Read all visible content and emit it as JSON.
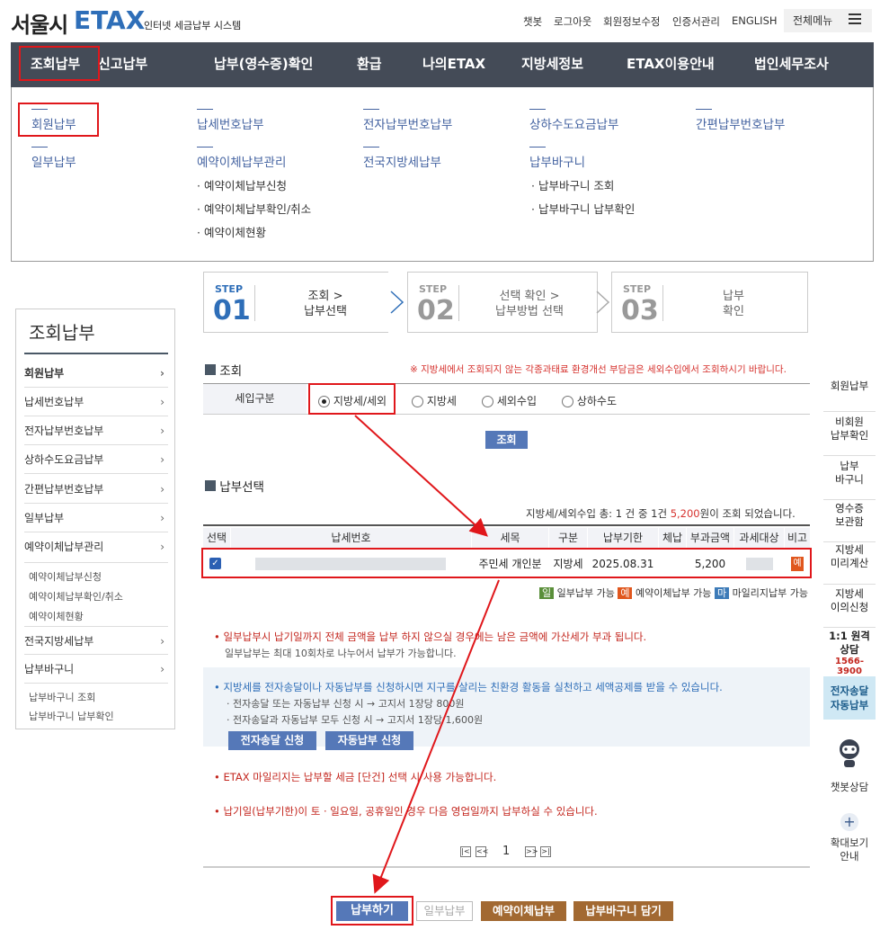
{
  "header": {
    "logo_main": "서울시",
    "logo_etax": "ETAX",
    "logo_sub": "인터넷 세금납부 시스템",
    "util": [
      "챗봇",
      "로그아웃",
      "회원정보수정",
      "인증서관리",
      "ENGLISH"
    ],
    "all_menu": "전체메뉴"
  },
  "gnb": [
    "조회납부",
    "신고납부",
    "납부(영수증)확인",
    "환급",
    "나의ETAX",
    "지방세정보",
    "ETAX이용안내",
    "법인세무조사"
  ],
  "mega": {
    "col1": [
      "회원납부",
      "일부납부"
    ],
    "col2": [
      "납세번호납부",
      "예약이체납부관리"
    ],
    "col2_sub": [
      "· 예약이체납부신청",
      "· 예약이체납부확인/취소",
      "· 예약이체현황"
    ],
    "col3": [
      "전자납부번호납부",
      "전국지방세납부"
    ],
    "col4": [
      "상하수도요금납부",
      "납부바구니"
    ],
    "col4_sub": [
      "· 납부바구니 조회",
      "· 납부바구니 납부확인"
    ],
    "col5": [
      "간편납부번호납부"
    ]
  },
  "steps": [
    {
      "label": "STEP",
      "num": "01",
      "text1": "조회 >",
      "text2": "납부선택"
    },
    {
      "label": "STEP",
      "num": "02",
      "text1": "선택 확인 >",
      "text2": "납부방법 선택"
    },
    {
      "label": "STEP",
      "num": "03",
      "text1": "납부",
      "text2": "확인"
    }
  ],
  "lnb": {
    "title": "조회납부",
    "items": [
      "회원납부",
      "납세번호납부",
      "전자납부번호납부",
      "상하수도요금납부",
      "간편납부번호납부",
      "일부납부",
      "예약이체납부관리"
    ],
    "sub1": [
      "예약이체납부신청",
      "예약이체납부확인/취소",
      "예약이체현황"
    ],
    "items2": [
      "전국지방세납부",
      "납부바구니"
    ],
    "sub2": [
      "납부바구니 조회",
      "납부바구니 납부확인"
    ]
  },
  "search": {
    "title": "조회",
    "notice": "※ 지방세에서 조회되지 않는 각종과태료 환경개선 부담금은 세외수입에서 조회하시기 바랍니다.",
    "row_label": "세입구분",
    "options": [
      "지방세/세외",
      "지방세",
      "세외수입",
      "상하수도"
    ],
    "button": "조회"
  },
  "select": {
    "title": "납부선택",
    "summary_pre": "지방세/세외수입 총: 1 건 중 1건",
    "summary_amt": "5,200",
    "summary_post": "원이 조회 되었습니다.",
    "headers": [
      "선택",
      "납세번호",
      "세목",
      "구분",
      "납부기한",
      "체납",
      "부과금액",
      "과세대상",
      "비고"
    ],
    "row": {
      "item": "주민세 개인분",
      "type": "지방세",
      "due": "2025.08.31",
      "overdue": "",
      "amount": "5,200",
      "badge": "예"
    },
    "legend": [
      {
        "badge": "일",
        "text": "일부납부 가능"
      },
      {
        "badge": "예",
        "text": "예약이체납부 가능"
      },
      {
        "badge": "마",
        "text": "마일리지납부 가능"
      }
    ]
  },
  "notes": {
    "n1": "일부납부시 납기일까지 전체 금액을 납부 하지 않으실 경우에는 남은 금액에 가산세가 부과 됩니다.",
    "n1_sub": "일부납부는 최대 10회차로 나누어서 납부가 가능합니다.",
    "n2": "지방세를 전자송달이나 자동납부를 신청하시면 지구를 살리는 친환경 활동을 실천하고 세액공제를 받을 수 있습니다.",
    "n2_sub1": "· 전자송달 또는 자동납부 신청 시 → 고지서 1장당 800원",
    "n2_sub2": "· 전자송달과 자동납부 모두 신청 시 → 고지서 1장당 1,600원",
    "btn_esong": "전자송달 신청",
    "btn_auto": "자동납부 신청",
    "n3": "ETAX 마일리지는 납부할 세금 [단건] 선택 시 사용 가능합니다.",
    "n4": "납기일(납부기한)이 토 · 일요일, 공휴일인 경우 다음 영업일까지 납부하실 수 있습니다."
  },
  "pager": {
    "first": "|<",
    "prev": "<<",
    "page": "1",
    "next": ">>",
    "last": ">|"
  },
  "actions": [
    "납부하기",
    "일부납부",
    "예약이체납부",
    "납부바구니 담기"
  ],
  "rbar": [
    "회원납부",
    "비회원\n납부확인",
    "납부\n바구니",
    "영수증\n보관함",
    "지방세\n미리계산",
    "지방세\n이의신청",
    "1:1 원격\n상담",
    "1566-3900",
    "전자송달\n자동납부",
    "챗봇상담",
    "확대보기\n안내"
  ]
}
